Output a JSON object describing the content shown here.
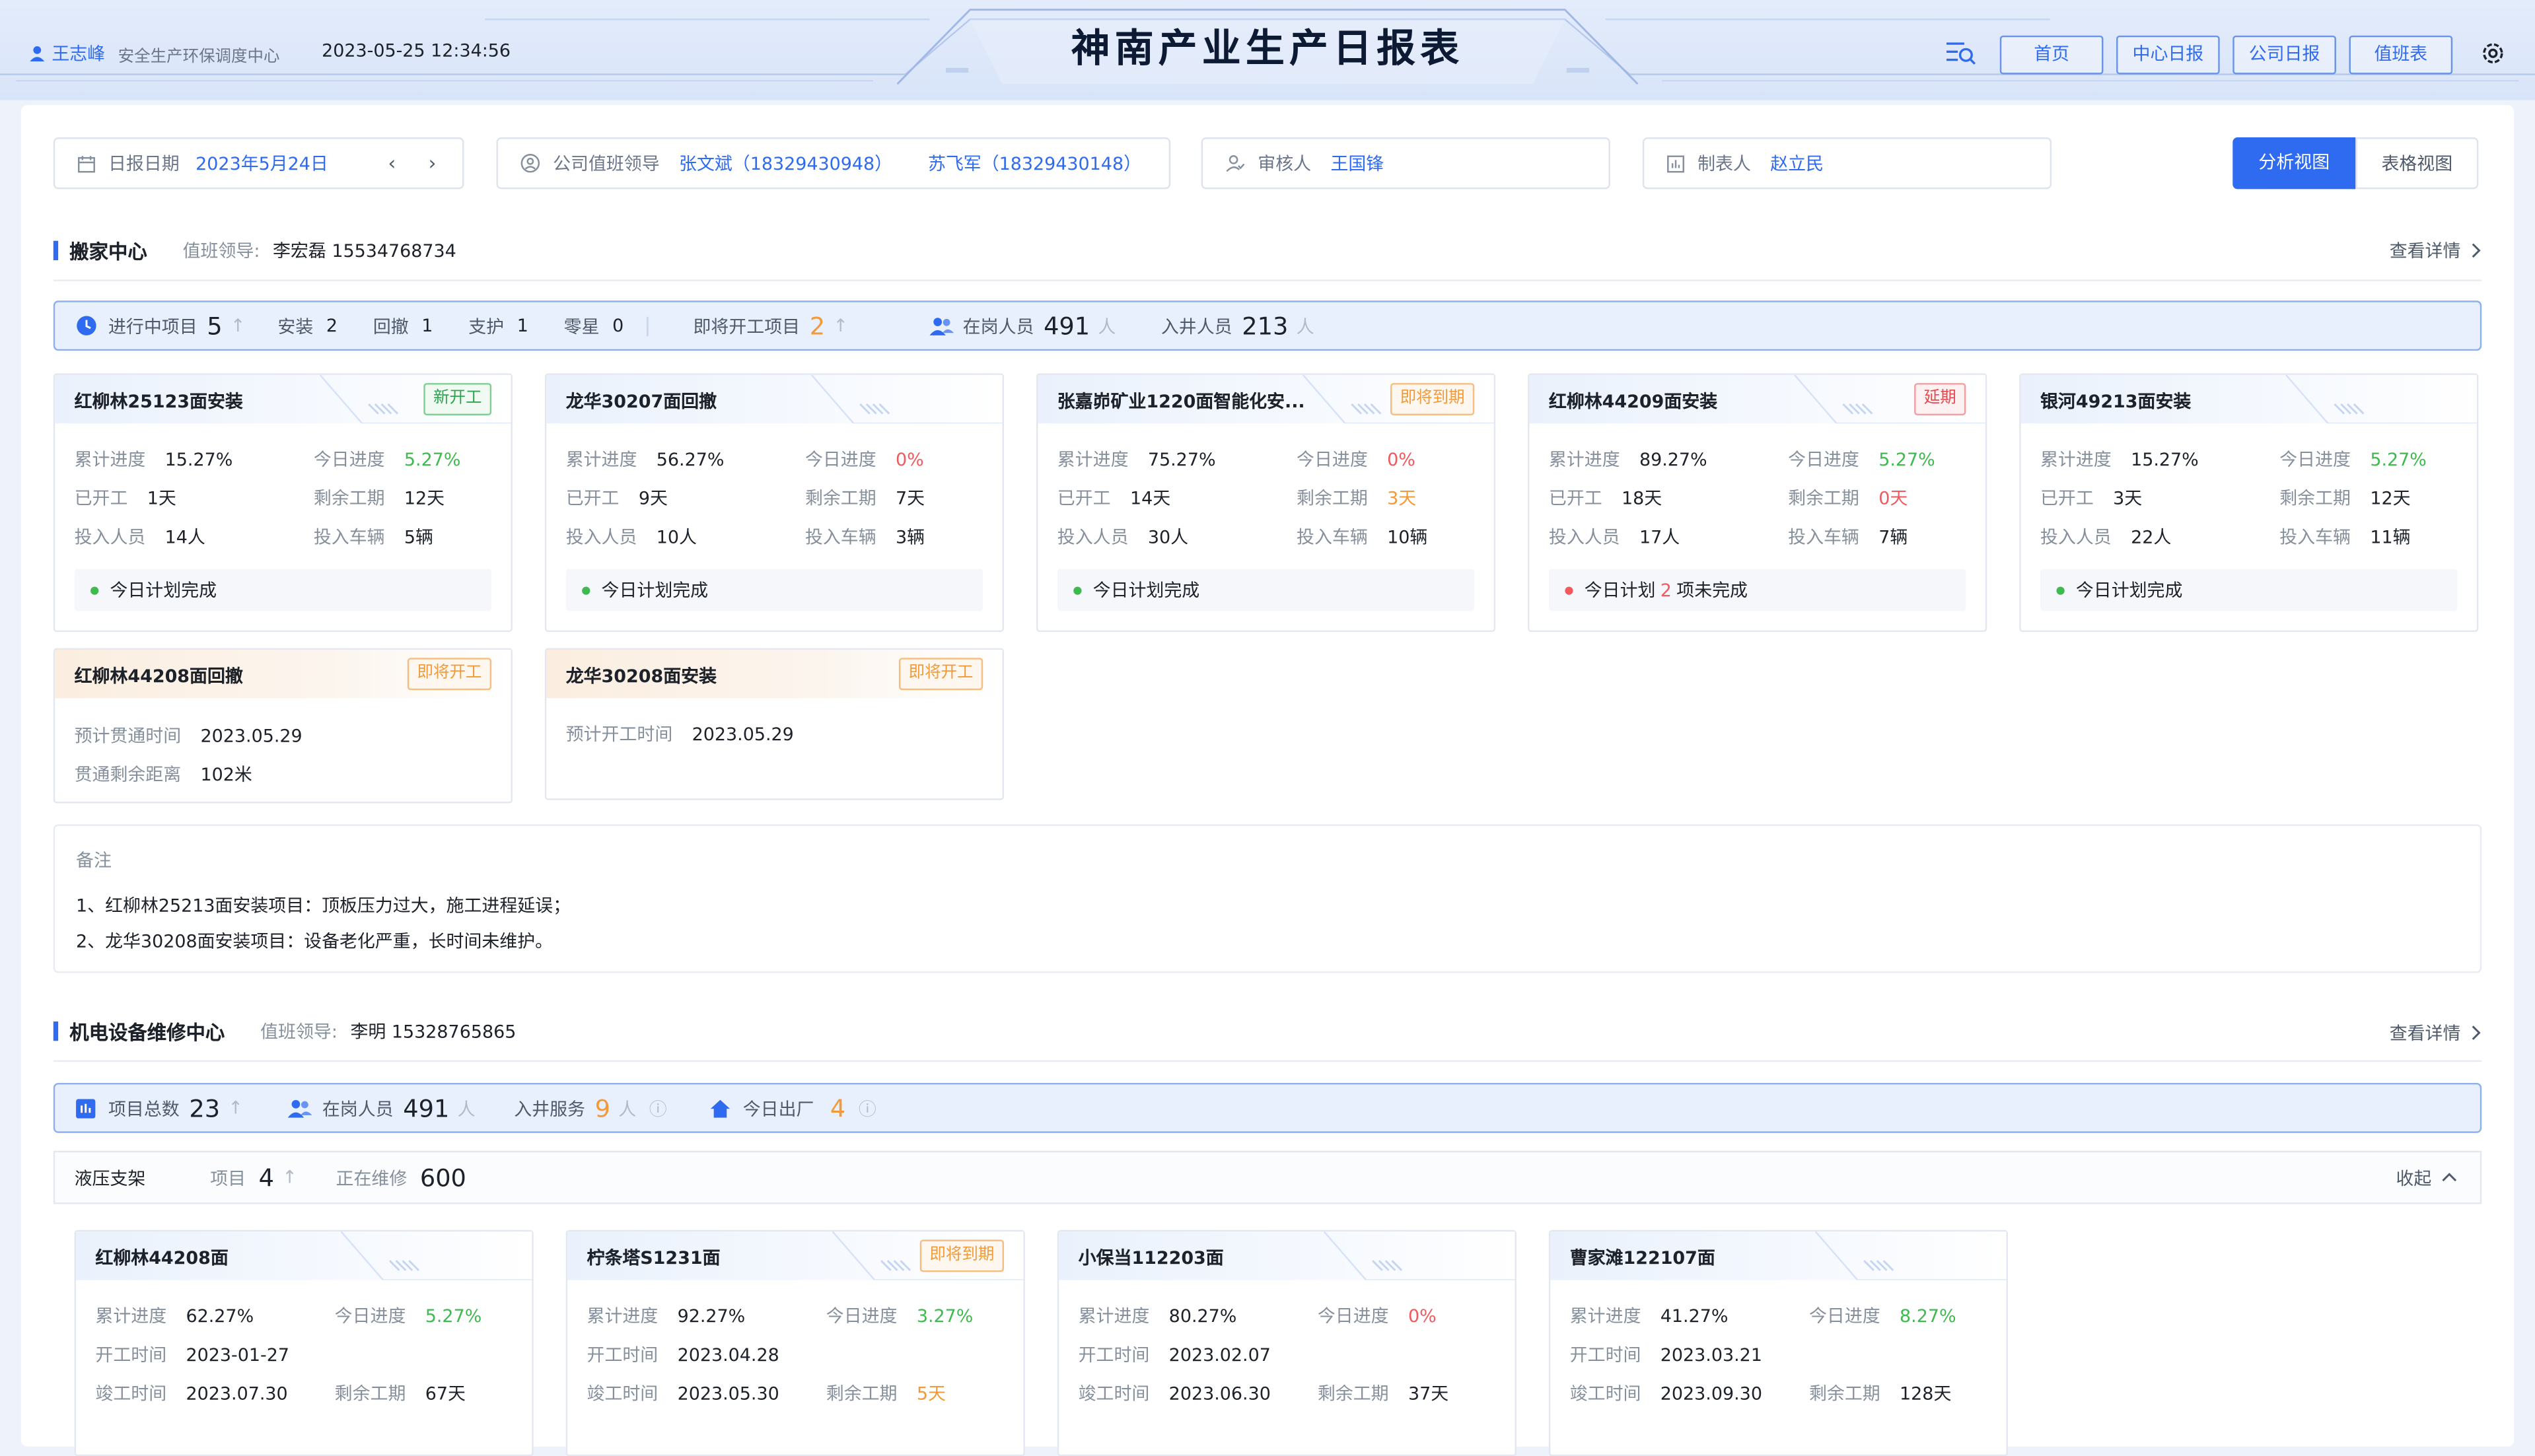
{
  "header": {
    "user_name": "王志峰",
    "user_dept": "安全生产环保调度中心",
    "datetime": "2023-05-25  12:34:56",
    "title": "神南产业生产日报表",
    "nav": [
      "首页",
      "中心日报",
      "公司日报",
      "值班表"
    ],
    "icons": [
      "search-list-icon",
      "settings-icon"
    ]
  },
  "filters": {
    "date_label": "日报日期",
    "date_value": "2023年5月24日",
    "leader_label": "公司值班领导",
    "leader_1": "张文斌（18329430948）",
    "leader_2": "苏飞军（18329430148）",
    "reviewer_label": "审核人",
    "reviewer": "王国锋",
    "maker_label": "制表人",
    "maker": "赵立民"
  },
  "views": {
    "analysis": "分析视图",
    "table": "表格视图"
  },
  "section1": {
    "name": "搬家中心",
    "leader_label": "值班领导:",
    "leader": "李宏磊  15534768734",
    "detail": "查看详情",
    "stats": {
      "ongoing_label": "进行中项目",
      "ongoing": "5",
      "install_label": "安装",
      "install": "2",
      "withdraw_label": "回撤",
      "withdraw": "1",
      "support_label": "支护",
      "support": "1",
      "misc_label": "零星",
      "misc": "0",
      "soon_label": "即将开工项目",
      "soon": "2",
      "staff_label": "在岗人员",
      "staff": "491",
      "staff_unit": "人",
      "well_label": "入井人员",
      "well": "213",
      "well_unit": "人"
    },
    "cards": [
      {
        "title": "红柳林25123面安装",
        "tag": "新开工",
        "tag_type": "green",
        "l1": "累计进度",
        "v1": "15.27%",
        "l2": "今日进度",
        "v2": "5.27%",
        "l3": "已开工",
        "v3": "1天",
        "l4": "剩余工期",
        "v4": "12天",
        "l5": "投入人员",
        "v5": "14人",
        "l6": "投入车辆",
        "v6": "5辆",
        "plan": "今日计划完成"
      },
      {
        "title": "龙华30207面回撤",
        "tag": "",
        "tag_type": "",
        "l1": "累计进度",
        "v1": "56.27%",
        "l2": "今日进度",
        "v2": "0%",
        "l3": "已开工",
        "v3": "9天",
        "l4": "剩余工期",
        "v4": "7天",
        "l5": "投入人员",
        "v5": "10人",
        "l6": "投入车辆",
        "v6": "3辆",
        "plan": "今日计划完成"
      },
      {
        "title": "张嘉峁矿业1220面智能化安...",
        "tag": "即将到期",
        "tag_type": "orange",
        "l1": "累计进度",
        "v1": "75.27%",
        "l2": "今日进度",
        "v2": "0%",
        "l3": "已开工",
        "v3": "14天",
        "l4": "剩余工期",
        "v4": "3天",
        "l5": "投入人员",
        "v5": "30人",
        "l6": "投入车辆",
        "v6": "10辆",
        "plan": "今日计划完成"
      },
      {
        "title": "红柳林44209面安装",
        "tag": "延期",
        "tag_type": "red",
        "l1": "累计进度",
        "v1": "89.27%",
        "l2": "今日进度",
        "v2": "5.27%",
        "l3": "已开工",
        "v3": "18天",
        "l4": "剩余工期",
        "v4": "0天",
        "l5": "投入人员",
        "v5": "17人",
        "l6": "投入车辆",
        "v6": "7辆",
        "plan_a": "今日计划",
        "plan_n": "2",
        "plan_b": "项未完成"
      },
      {
        "title": "银河49213面安装",
        "tag": "",
        "tag_type": "",
        "l1": "累计进度",
        "v1": "15.27%",
        "l2": "今日进度",
        "v2": "5.27%",
        "l3": "已开工",
        "v3": "3天",
        "l4": "剩余工期",
        "v4": "12天",
        "l5": "投入人员",
        "v5": "22人",
        "l6": "投入车辆",
        "v6": "11辆",
        "plan": "今日计划完成"
      }
    ],
    "upcoming": [
      {
        "title": "红柳林44208面回撤",
        "tag": "即将开工",
        "l1": "预计贯通时间",
        "v1": "2023.05.29",
        "l2": "贯通剩余距离",
        "v2": "102米"
      },
      {
        "title": "龙华30208面安装",
        "tag": "即将开工",
        "l1": "预计开工时间",
        "v1": "2023.05.29"
      }
    ],
    "notes_title": "备注",
    "notes": [
      "1、红柳林25213面安装项目：顶板压力过大，施工进程延误；",
      "2、龙华30208面安装项目：设备老化严重，长时间未维护。"
    ]
  },
  "section2": {
    "name": "机电设备维修中心",
    "leader_label": "值班领导:",
    "leader": "李明  15328765865",
    "detail": "查看详情",
    "stats": {
      "total_label": "项目总数",
      "total": "23",
      "staff_label": "在岗人员",
      "staff": "491",
      "staff_unit": "人",
      "service_label": "入井服务",
      "service": "9",
      "service_unit": "人",
      "out_label": "今日出厂",
      "out": "4"
    },
    "sub": {
      "name": "液压支架",
      "proj_label": "项目",
      "proj": "4",
      "repair_label": "正在维修",
      "repair": "600",
      "collapse": "收起"
    },
    "cards": [
      {
        "title": "红柳林44208面",
        "tag": "",
        "l1": "累计进度",
        "v1": "62.27%",
        "l2": "今日进度",
        "v2": "5.27%",
        "l3": "开工时间",
        "v3": "2023-01-27",
        "l4": "竣工时间",
        "v4": "2023.07.30",
        "l5": "剩余工期",
        "v5": "67天"
      },
      {
        "title": "柠条塔S1231面",
        "tag": "即将到期",
        "l1": "累计进度",
        "v1": "92.27%",
        "l2": "今日进度",
        "v2": "3.27%",
        "l3": "开工时间",
        "v3": "2023.04.28",
        "l4": "竣工时间",
        "v4": "2023.05.30",
        "l5": "剩余工期",
        "v5": "5天"
      },
      {
        "title": "小保当112203面",
        "tag": "",
        "l1": "累计进度",
        "v1": "80.27%",
        "l2": "今日进度",
        "v2": "0%",
        "l3": "开工时间",
        "v3": "2023.02.07",
        "l4": "竣工时间",
        "v4": "2023.06.30",
        "l5": "剩余工期",
        "v5": "37天"
      },
      {
        "title": "曹家滩122107面",
        "tag": "",
        "l1": "累计进度",
        "v1": "41.27%",
        "l2": "今日进度",
        "v2": "8.27%",
        "l3": "开工时间",
        "v3": "2023.03.21",
        "l4": "竣工时间",
        "v4": "2023.09.30",
        "l5": "剩余工期",
        "v5": "128天"
      }
    ]
  },
  "colors": {
    "accent": "#2f6bf0",
    "green": "#3fb950",
    "red": "#f05a5f",
    "orange": "#f29a38"
  }
}
